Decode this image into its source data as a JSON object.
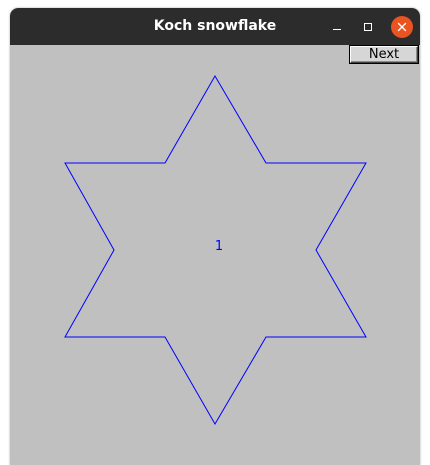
{
  "window": {
    "title": "Koch snowflake"
  },
  "toolbar": {
    "next_label": "Next"
  },
  "canvas": {
    "iteration": "1",
    "stroke_color": "#0000ff",
    "background": "#c0c0c0"
  },
  "icons": {
    "minimize": "minimize-icon",
    "maximize": "maximize-icon",
    "close": "close-icon"
  }
}
